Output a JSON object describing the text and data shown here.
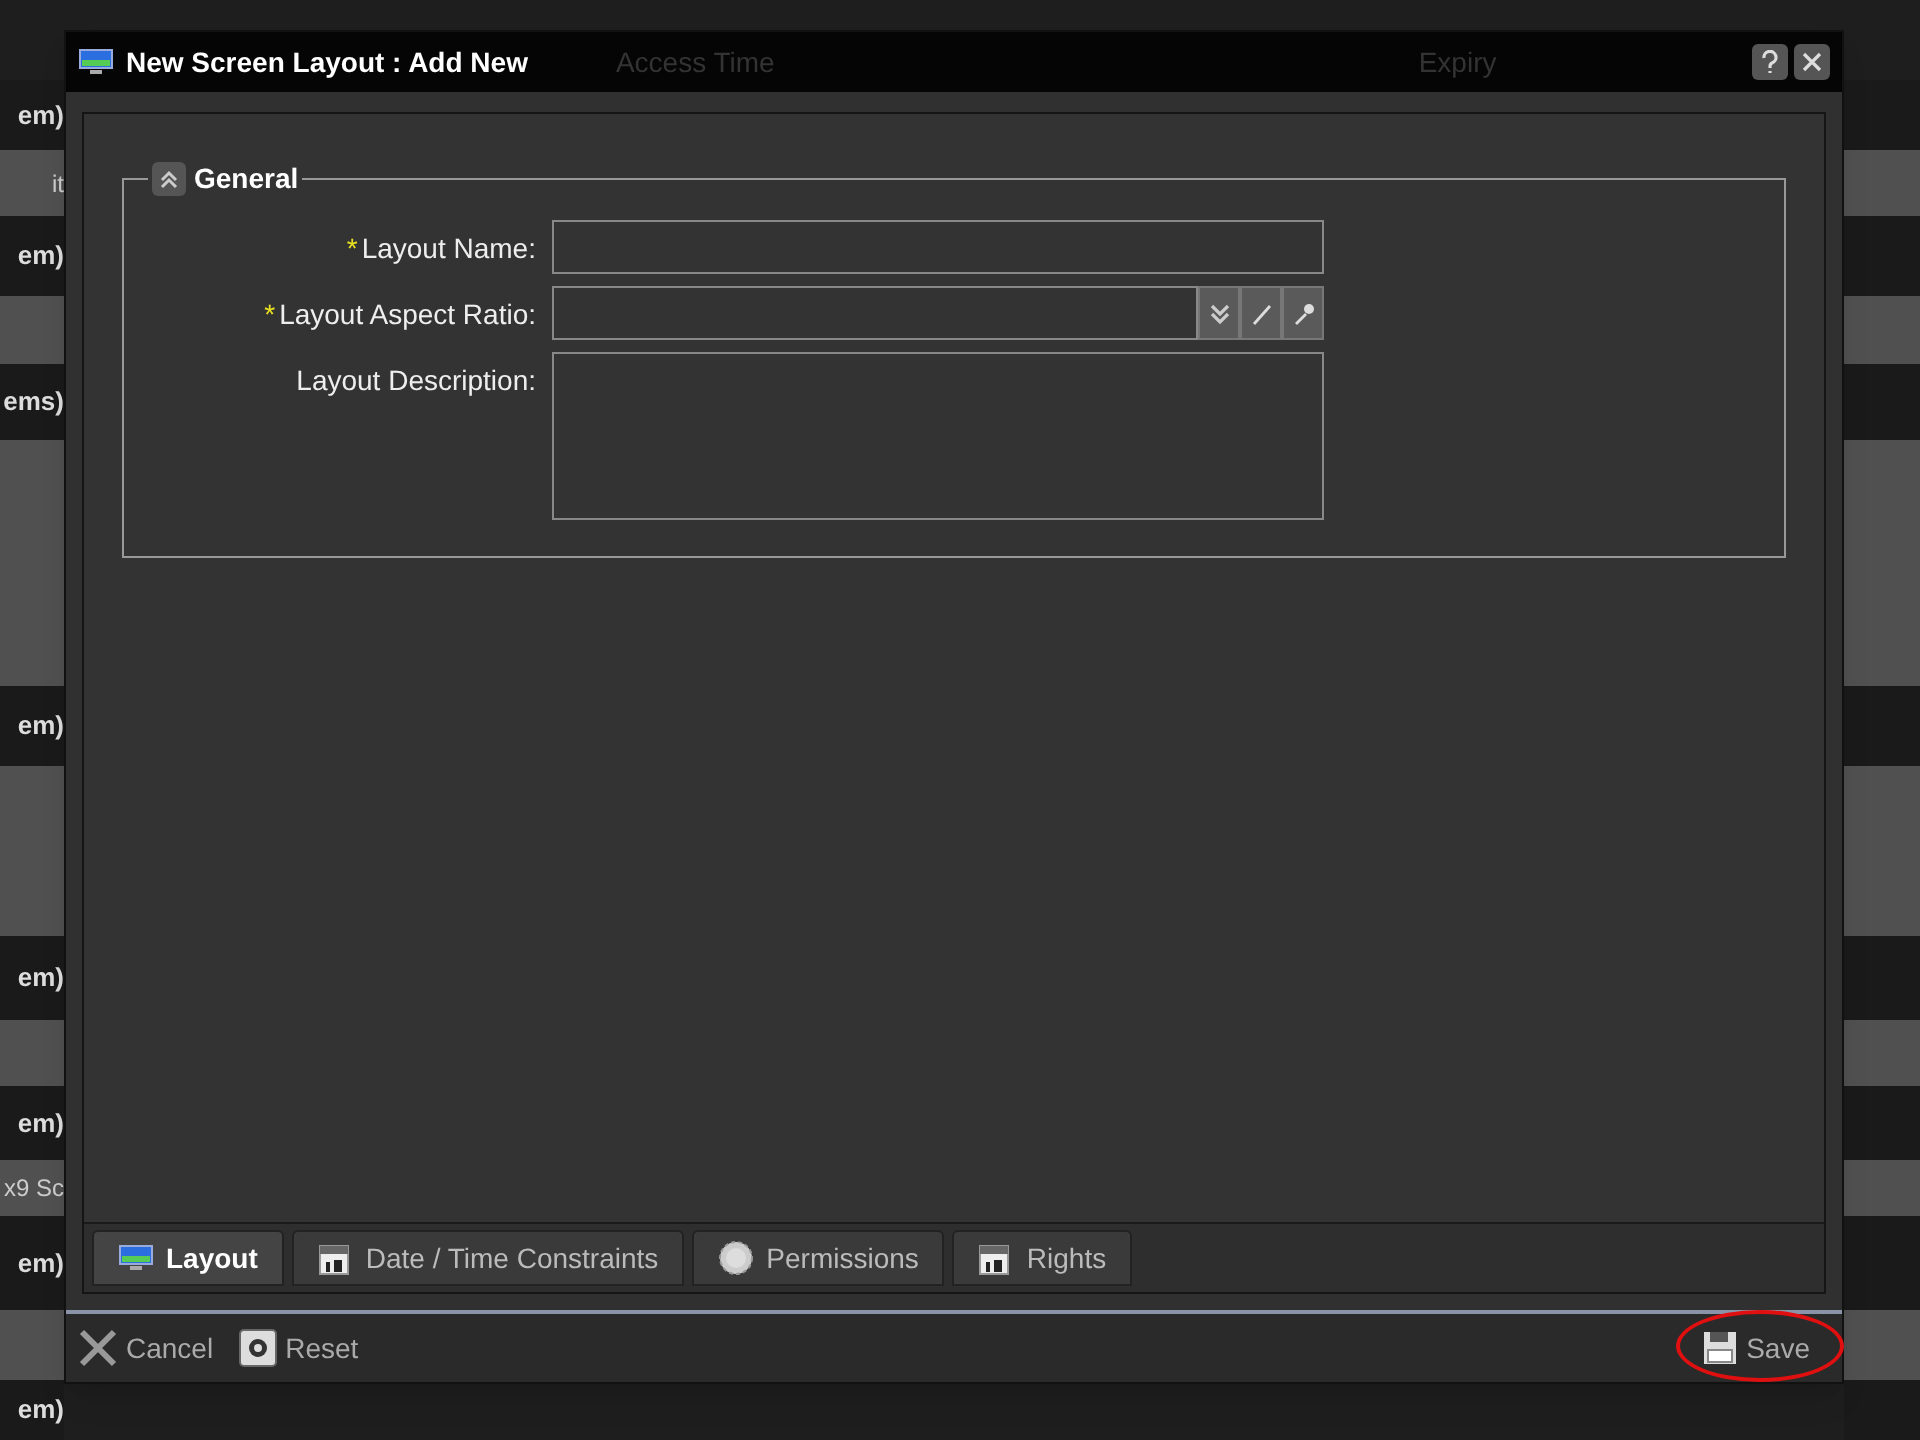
{
  "background": {
    "header_columns": [
      "Access Time",
      "Expiry"
    ],
    "left_rows": [
      {
        "kind": "group",
        "text": "em)"
      },
      {
        "kind": "item",
        "text": "it"
      },
      {
        "kind": "group",
        "text": "em)"
      },
      {
        "kind": "item"
      },
      {
        "kind": "group",
        "text": "ems)"
      },
      {
        "kind": "item"
      },
      {
        "kind": "item"
      },
      {
        "kind": "group",
        "text": "em)"
      },
      {
        "kind": "item"
      },
      {
        "kind": "group",
        "text": "em)"
      },
      {
        "kind": "item"
      },
      {
        "kind": "group",
        "text": "em)"
      },
      {
        "kind": "item",
        "text": "x9 Sc"
      },
      {
        "kind": "group",
        "text": "em)"
      },
      {
        "kind": "item"
      },
      {
        "kind": "group",
        "text": "em)"
      }
    ]
  },
  "dialog": {
    "title": "New Screen Layout : Add New",
    "section": {
      "title": "General",
      "expanded": true,
      "fields": [
        {
          "kind": "text",
          "label": "Layout Name:",
          "required": true
        },
        {
          "kind": "combo",
          "label": "Layout Aspect Ratio:",
          "required": true,
          "required_mark": "*"
        },
        {
          "kind": "textarea",
          "label": "Layout Description:",
          "required": false
        }
      ],
      "required_mark": "*"
    },
    "tabs": [
      {
        "label": "Layout",
        "kind": "display",
        "selected": true
      },
      {
        "label": "Date / Time Constraints",
        "kind": "schedule",
        "selected": false
      },
      {
        "label": "Permissions",
        "kind": "permission",
        "selected": false
      },
      {
        "label": "Rights",
        "kind": "schedule",
        "selected": false
      }
    ],
    "footer": {
      "left_buttons": [
        {
          "label": "Cancel"
        },
        {
          "label": "Reset"
        }
      ],
      "save": {
        "label": "Save",
        "highlighted": true
      }
    }
  }
}
